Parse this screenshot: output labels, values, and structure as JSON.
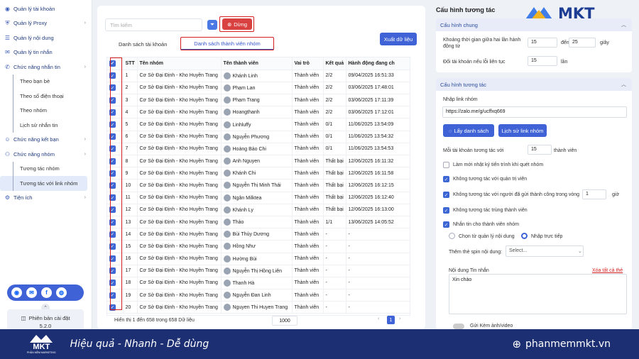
{
  "sidebar": {
    "items": [
      {
        "label": "Quản lý tài khoản",
        "icon": "user-icon",
        "chev": false,
        "sub": false,
        "active": false
      },
      {
        "label": "Quản lý Proxy",
        "icon": "proxy-icon",
        "chev": true,
        "sub": false,
        "active": false
      },
      {
        "label": "Quản lý nội dung",
        "icon": "content-icon",
        "chev": false,
        "sub": false,
        "active": false
      },
      {
        "label": "Quản lý tin nhắn",
        "icon": "message-icon",
        "chev": false,
        "sub": false,
        "active": false
      },
      {
        "label": "Chức năng nhắn tin",
        "icon": "chat-icon",
        "chev": true,
        "sub": false,
        "active": false
      },
      {
        "label": "Theo bạn bè",
        "icon": "",
        "chev": false,
        "sub": true,
        "active": false
      },
      {
        "label": "Theo số điện thoại",
        "icon": "",
        "chev": false,
        "sub": true,
        "active": false
      },
      {
        "label": "Theo nhóm",
        "icon": "",
        "chev": false,
        "sub": true,
        "active": false
      },
      {
        "label": "Lịch sử nhắn tin",
        "icon": "",
        "chev": false,
        "sub": true,
        "active": false
      },
      {
        "label": "Chức năng kết bạn",
        "icon": "friend-icon",
        "chev": true,
        "sub": false,
        "active": false
      },
      {
        "label": "Chức năng nhóm",
        "icon": "group-icon",
        "chev": true,
        "sub": false,
        "active": false
      },
      {
        "label": "Tương tác nhóm",
        "icon": "",
        "chev": false,
        "sub": true,
        "active": false
      },
      {
        "label": "Tương tác với link nhóm",
        "icon": "",
        "chev": false,
        "sub": true,
        "active": true
      },
      {
        "label": "Tiện ích",
        "icon": "utility-icon",
        "chev": true,
        "sub": false,
        "active": false
      }
    ],
    "version_label": "Phiên bản cài đặt",
    "version": "5.2.0"
  },
  "toolbar": {
    "search_placeholder": "Tìm kiếm",
    "stop_label": "Dừng",
    "export_label": "Xuất dữ liệu"
  },
  "tabs": {
    "accounts": "Danh sách tài khoản",
    "members": "Danh sách thành viên nhóm"
  },
  "table": {
    "headers": [
      "STT",
      "Tên nhóm",
      "Tên thành viên",
      "Vai trò",
      "Kết quả",
      "Hành động đang ch"
    ],
    "rows": [
      [
        "1",
        "Cơ Sở Đại Định - Kho Huyền Trang",
        "Khánh Linh",
        "Thành viên",
        "2/2",
        "09/04/2025 16:51:33"
      ],
      [
        "2",
        "Cơ Sở Đại Định - Kho Huyền Trang",
        "Phạm Lan",
        "Thành viên",
        "2/2",
        "03/06/2025 17:48:01"
      ],
      [
        "3",
        "Cơ Sở Đại Định - Kho Huyền Trang",
        "Phạm Trang",
        "Thành viên",
        "2/2",
        "03/06/2025 17:11:39"
      ],
      [
        "4",
        "Cơ Sở Đại Định - Kho Huyền Trang",
        "Hoangthanh",
        "Thành viên",
        "2/2",
        "03/06/2025 17:12:01"
      ],
      [
        "5",
        "Cơ Sở Đại Định - Kho Huyền Trang",
        "Linhluffy",
        "Thành viên",
        "0/1",
        "11/06/2025 13:54:09"
      ],
      [
        "6",
        "Cơ Sở Đại Định - Kho Huyền Trang",
        "Nguyễn Phương",
        "Thành viên",
        "0/1",
        "11/06/2025 13:54:32"
      ],
      [
        "7",
        "Cơ Sở Đại Định - Kho Huyền Trang",
        "Hoàng Bảo Chi",
        "Thành viên",
        "0/1",
        "11/06/2025 13:54:53"
      ],
      [
        "8",
        "Cơ Sở Đại Định - Kho Huyền Trang",
        "Anh Nguyen",
        "Thành viên",
        "Thất bại",
        "12/06/2025 16:11:32"
      ],
      [
        "9",
        "Cơ Sở Đại Định - Kho Huyền Trang",
        "Khánh Chi",
        "Thành viên",
        "Thất bại",
        "12/06/2025 16:11:58"
      ],
      [
        "10",
        "Cơ Sở Đại Định - Kho Huyền Trang",
        "Nguyễn Thị Minh Thái",
        "Thành viên",
        "Thất bại",
        "12/06/2025 16:12:15"
      ],
      [
        "11",
        "Cơ Sở Đại Định - Kho Huyền Trang",
        "Ngân Milktea",
        "Thành viên",
        "Thất bại",
        "12/06/2025 16:12:40"
      ],
      [
        "12",
        "Cơ Sở Đại Định - Kho Huyền Trang",
        "Khánh Ly",
        "Thành viên",
        "Thất bại",
        "12/06/2025 16:13:00"
      ],
      [
        "13",
        "Cơ Sở Đại Định - Kho Huyền Trang",
        "Thảo",
        "Thành viên",
        "1/1",
        "13/06/2025 14:05:52"
      ],
      [
        "14",
        "Cơ Sở Đại Định - Kho Huyền Trang",
        "Bùi Thủy Dương",
        "Thành viên",
        "-",
        "-"
      ],
      [
        "15",
        "Cơ Sở Đại Định - Kho Huyền Trang",
        "Hồng Như",
        "Thành viên",
        "-",
        "-"
      ],
      [
        "16",
        "Cơ Sở Đại Định - Kho Huyền Trang",
        "Hường Bùi",
        "Thành viên",
        "-",
        "-"
      ],
      [
        "17",
        "Cơ Sở Đại Định - Kho Huyền Trang",
        "Nguyễn Thị Hồng Liên",
        "Thành viên",
        "-",
        "-"
      ],
      [
        "18",
        "Cơ Sở Đại Định - Kho Huyền Trang",
        "Thanh Hà",
        "Thành viên",
        "-",
        "-"
      ],
      [
        "19",
        "Cơ Sở Đại Định - Kho Huyền Trang",
        "Nguyễn Đan Linh",
        "Thành viên",
        "-",
        "-"
      ],
      [
        "20",
        "Cơ Sở Đại Định - Kho Huyền Trang",
        "Nguyen Thi Huyen Trang",
        "Thành viên",
        "-",
        "-"
      ]
    ],
    "footer": "Hiển thị 1 đến 658 trong 658 Dữ liệu",
    "page_size": "1000",
    "current_page": "1",
    "prev": "‹",
    "next": "›"
  },
  "right": {
    "title": "Cấu hình tương tác",
    "logo_text": "MKT",
    "general": {
      "header": "Cấu hình chung",
      "delay_label": "Khoảng thời gian giữa hai lần hành động từ",
      "delay_from": "15",
      "to_label": "đến",
      "delay_to": "25",
      "seconds": "giây",
      "switch_label": "Đổi tài khoản nếu lỗi liên tục",
      "switch_value": "15",
      "times": "lần"
    },
    "interact": {
      "header": "Cấu hình tương tác",
      "link_label": "Nhập link nhóm",
      "link_value": "https://zalo.me/g/ucffxq669",
      "get_list": "Lấy danh sách",
      "history": "Lịch sử link nhóm",
      "per_account_label": "Mỗi tài khoản tương tác với",
      "per_account_value": "15",
      "members": "thành viên",
      "opt_refresh": "Làm mới nhật ký tiến trình khi quét nhóm",
      "opt_no_admin": "Không tương tác với quản trị viên",
      "opt_no_sent": "Không tương tác với người đã gửi thành công trong vòng",
      "opt_no_sent_value": "1",
      "hours": "giờ",
      "opt_no_dup": "Không tương tác trùng thành viên",
      "opt_message": "Nhắn tin cho thành viên nhóm",
      "radio_manage": "Chọn từ quản lý nội dung",
      "radio_direct": "Nhập trực tiếp",
      "spin_label": "Thêm thẻ spin nội dung:",
      "spin_placeholder": "Select...",
      "content_label": "Nội dung Tin nhắn",
      "clear_all": "Xóa tất cả thẻ",
      "content_value": "Xin chào",
      "attach_label": "Gửi Kèm ảnh/video"
    }
  },
  "banner": {
    "logo": "MKT",
    "logo_sub": "PHẦN MỀM MARKETING",
    "slogan": "Hiệu quả - Nhanh - Dễ dùng",
    "website": "phanmemmkt.vn"
  },
  "colors": {
    "accent": "#3f63d6",
    "danger": "#d94040",
    "banner": "#1c2f73"
  }
}
